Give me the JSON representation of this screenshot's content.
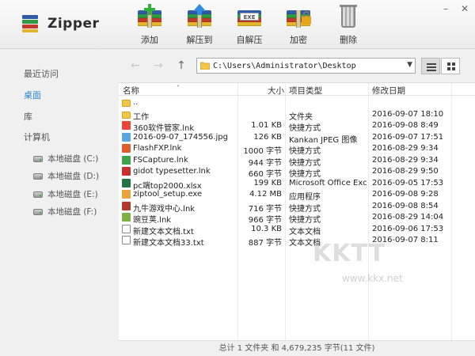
{
  "app": {
    "title": "Zipper"
  },
  "toolbar": [
    {
      "id": "add",
      "label": "添加",
      "icon": "add-archive-icon"
    },
    {
      "id": "extract",
      "label": "解压到",
      "icon": "extract-archive-icon"
    },
    {
      "id": "sfx",
      "label": "自解压",
      "icon": "self-extract-icon",
      "badge": "EXE"
    },
    {
      "id": "encrypt",
      "label": "加密",
      "icon": "encrypt-archive-icon"
    },
    {
      "id": "delete",
      "label": "删除",
      "icon": "trash-icon"
    }
  ],
  "window_controls": {
    "minimize": "–",
    "close": "✕"
  },
  "sidebar": {
    "items": [
      {
        "label": "最近访问",
        "active": false
      },
      {
        "label": "桌面",
        "active": true
      },
      {
        "label": "库",
        "active": false
      },
      {
        "label": "计算机",
        "active": false
      }
    ],
    "drives": [
      {
        "label": "本地磁盘 (C:)"
      },
      {
        "label": "本地磁盘 (D:)"
      },
      {
        "label": "本地磁盘 (E:)"
      },
      {
        "label": "本地磁盘 (F:)"
      }
    ]
  },
  "addressbar": {
    "path": "C:\\Users\\Administrator\\Desktop"
  },
  "columns": {
    "name": "名称",
    "size": "大小",
    "type": "项目类型",
    "date": "修改日期"
  },
  "files": [
    {
      "name": "..",
      "size": "",
      "type": "",
      "date": "",
      "icon": "folder",
      "color": "#f2c748"
    },
    {
      "name": "工作",
      "size": "",
      "type": "文件夹",
      "date": "2016-09-07 18:10",
      "icon": "folder",
      "color": "#f2c748"
    },
    {
      "name": "360软件管家.lnk",
      "size": "1.01 KB",
      "type": "快捷方式",
      "date": "2016-09-08 8:49",
      "icon": "app",
      "color": "#e8473a"
    },
    {
      "name": "2016-09-07_174556.jpg",
      "size": "126 KB",
      "type": "Kankan JPEG 图像",
      "date": "2016-09-07 17:51",
      "icon": "app",
      "color": "#5aa6de"
    },
    {
      "name": "FlashFXP.lnk",
      "size": "1000 字节",
      "type": "快捷方式",
      "date": "2016-08-29 9:34",
      "icon": "app",
      "color": "#e35b2b"
    },
    {
      "name": "FSCapture.lnk",
      "size": "944 字节",
      "type": "快捷方式",
      "date": "2016-08-29 9:34",
      "icon": "app",
      "color": "#3da449"
    },
    {
      "name": "gidot typesetter.lnk",
      "size": "660 字节",
      "type": "快捷方式",
      "date": "2016-08-29 9:50",
      "icon": "app",
      "color": "#c9302c"
    },
    {
      "name": "pc端top2000.xlsx",
      "size": "199 KB",
      "type": "Microsoft Office Excel...",
      "date": "2016-09-05 17:53",
      "icon": "app",
      "color": "#217346"
    },
    {
      "name": "ziptool_setup.exe",
      "size": "4.12 MB",
      "type": "应用程序",
      "date": "2016-09-08 9:28",
      "icon": "app",
      "color": "#e8a33a"
    },
    {
      "name": "九牛游戏中心.lnk",
      "size": "716 字节",
      "type": "快捷方式",
      "date": "2016-09-08 8:54",
      "icon": "app",
      "color": "#b33a2b"
    },
    {
      "name": "豌豆荚.lnk",
      "size": "966 字节",
      "type": "快捷方式",
      "date": "2016-08-29 14:04",
      "icon": "app",
      "color": "#7cb342"
    },
    {
      "name": "新建文本文档.txt",
      "size": "10.3 KB",
      "type": "文本文档",
      "date": "2016-09-06 17:53",
      "icon": "doc",
      "color": "#ffffff"
    },
    {
      "name": "新建文本文档33.txt",
      "size": "887 字节",
      "type": "文本文档",
      "date": "2016-09-07 8:11",
      "icon": "doc",
      "color": "#ffffff"
    }
  ],
  "status": "总计 1 文件夹 和 4,679,235 字节(11 文件)",
  "watermark": {
    "text": "KKTT",
    "url": "www.kkx.net"
  }
}
